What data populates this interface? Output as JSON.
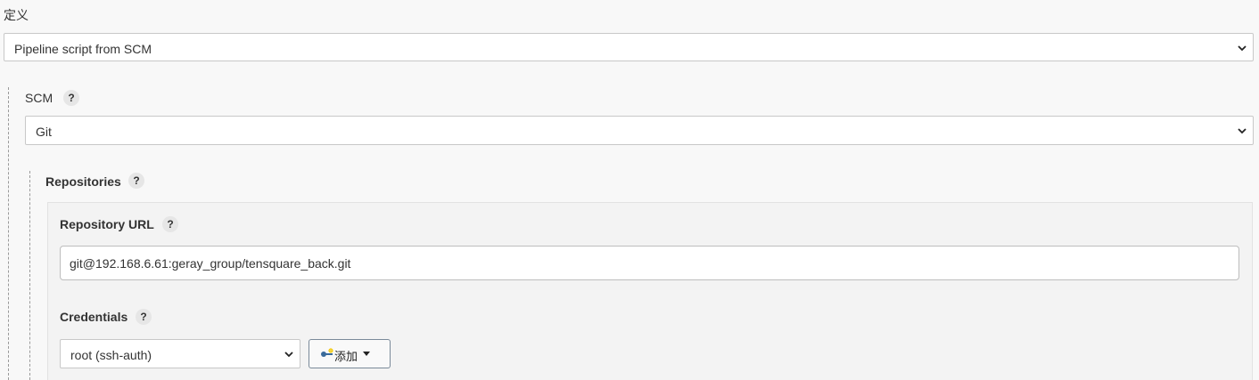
{
  "definition": {
    "label": "定义",
    "selected": "Pipeline script from SCM"
  },
  "scm": {
    "label": "SCM",
    "help": "?",
    "selected": "Git"
  },
  "repositories": {
    "label": "Repositories",
    "help": "?",
    "repository_url": {
      "label": "Repository URL",
      "help": "?",
      "value": "git@192.168.6.61:geray_group/tensquare_back.git"
    },
    "credentials": {
      "label": "Credentials",
      "help": "?",
      "selected": "root (ssh-auth)",
      "add_button_label": "添加"
    }
  },
  "icons": {
    "dropdown": "chevron-down-icon",
    "help": "question-mark-icon",
    "credential": "key-icon",
    "add_menu": "caret-down-icon"
  },
  "colors": {
    "page_bg": "#f8f8f8",
    "panel_bg": "#f3f3f3",
    "help_bg": "#e6e6e6",
    "input_border": "#bdbdbd",
    "button_border": "#7a8a99"
  }
}
